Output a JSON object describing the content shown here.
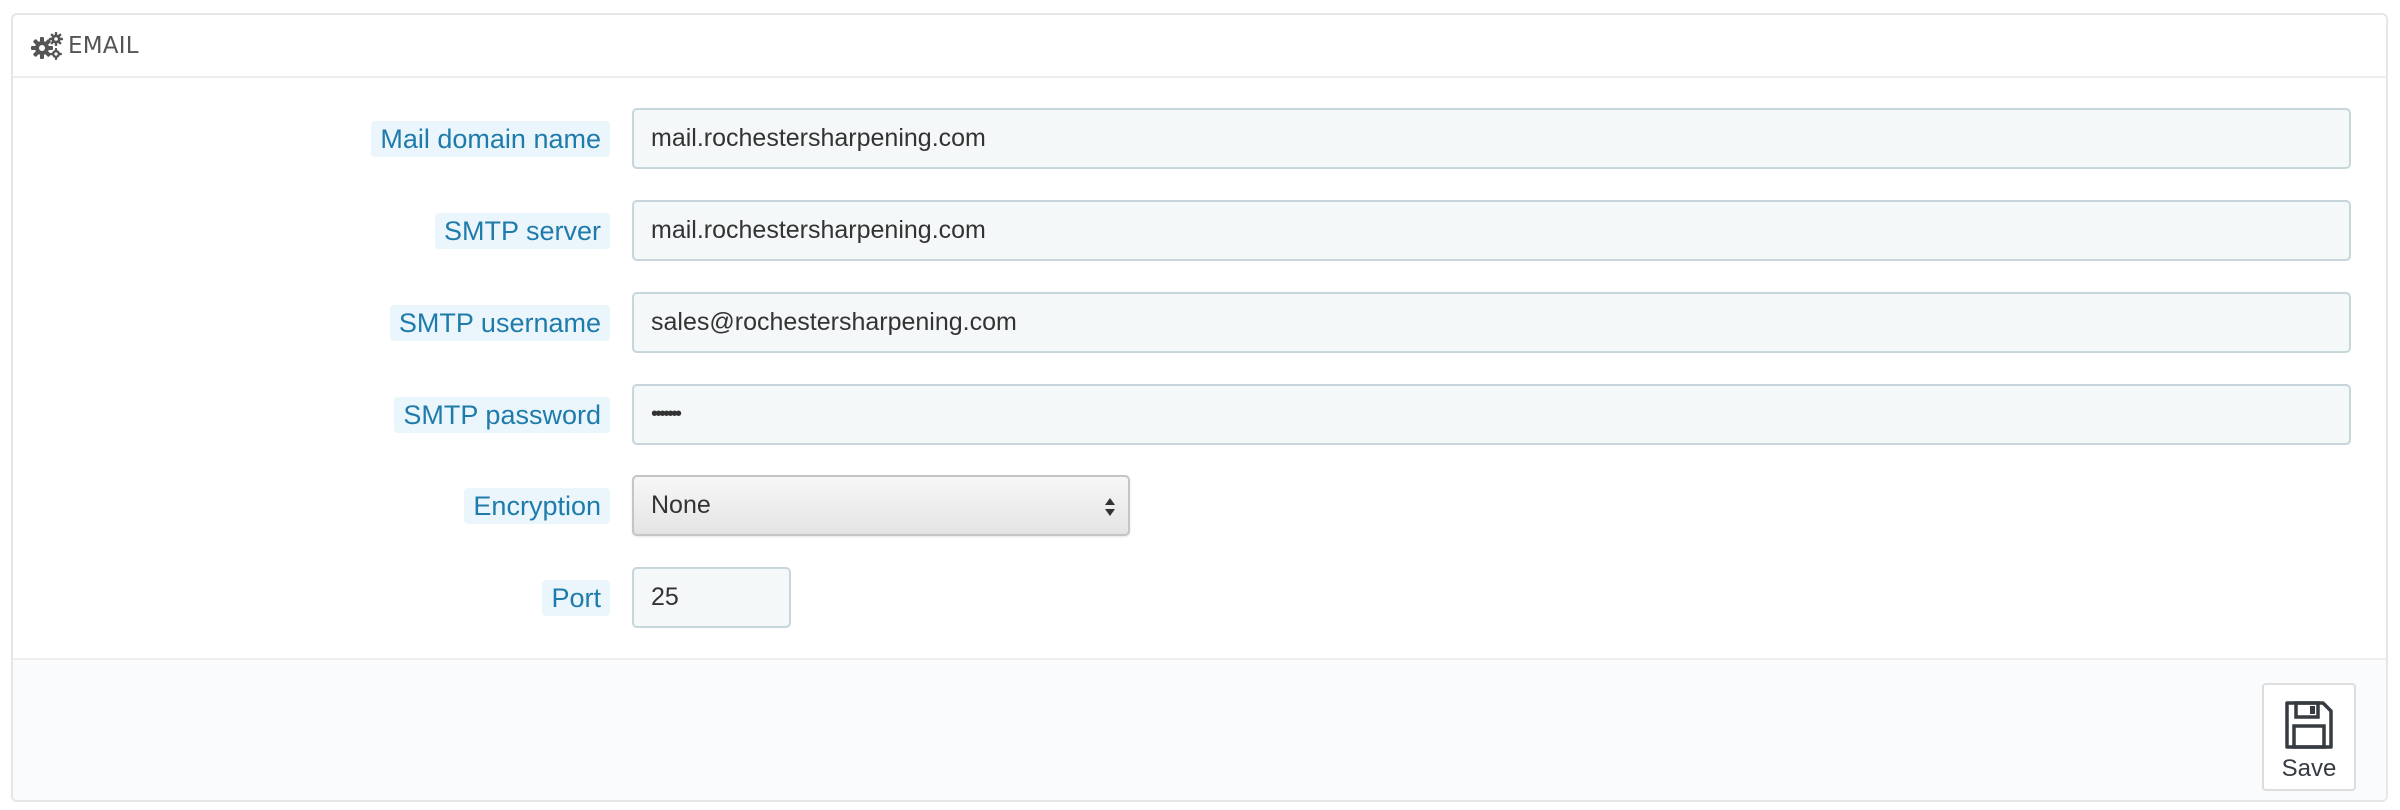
{
  "panel": {
    "title": "EMAIL",
    "icon": "gears-icon"
  },
  "fields": {
    "mail_domain": {
      "label": "Mail domain name",
      "value": "mail.rochestersharpening.com"
    },
    "smtp_server": {
      "label": "SMTP server",
      "value": "mail.rochestersharpening.com"
    },
    "smtp_username": {
      "label": "SMTP username",
      "value": "sales@rochestersharpening.com"
    },
    "smtp_password": {
      "label": "SMTP password",
      "value": "•••••••"
    },
    "encryption": {
      "label": "Encryption",
      "value": "None"
    },
    "port": {
      "label": "Port",
      "value": "25"
    }
  },
  "footer": {
    "save_label": "Save",
    "save_icon": "floppy-disk-icon"
  },
  "colors": {
    "label_text": "#1f7bab",
    "label_bg": "#eaf6fb",
    "input_bg": "#f5f8f9",
    "input_border": "#c7d6db"
  }
}
